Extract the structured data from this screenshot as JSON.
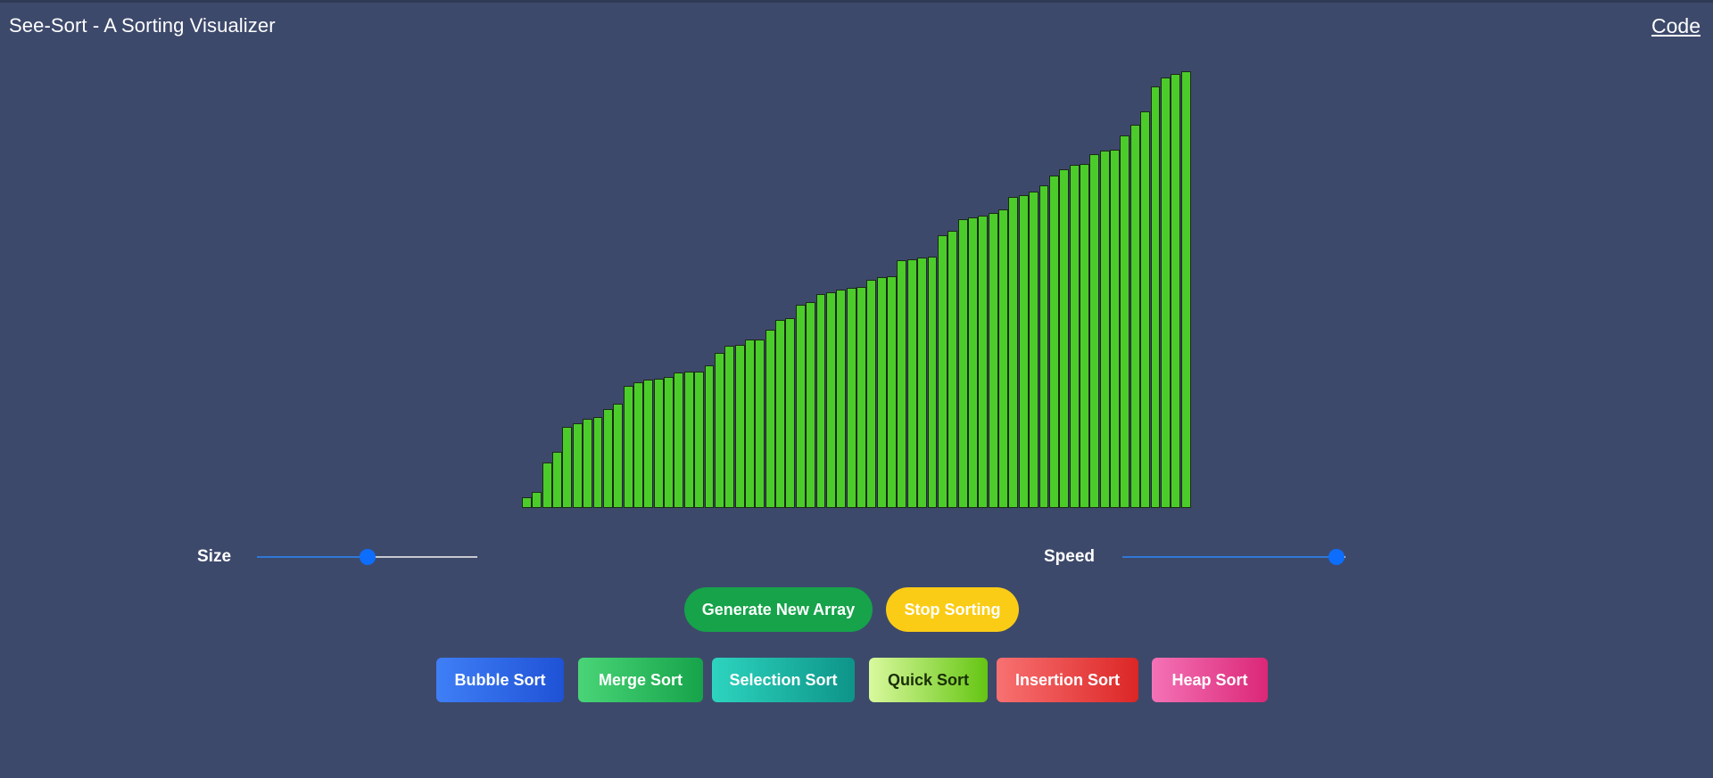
{
  "header": {
    "title": "See-Sort - A Sorting Visualizer",
    "code_link": "Code"
  },
  "array_values": [
    12,
    18,
    50,
    62,
    90,
    94,
    99,
    101,
    110,
    116,
    135,
    139,
    142,
    143,
    145,
    150,
    151,
    151,
    158,
    172,
    180,
    181,
    187,
    187,
    198,
    208,
    210,
    225,
    228,
    237,
    239,
    242,
    244,
    245,
    253,
    256,
    257,
    275,
    276,
    278,
    279,
    302,
    307,
    320,
    322,
    324,
    327,
    331,
    345,
    347,
    351,
    358,
    368,
    375,
    380,
    381,
    392,
    396,
    397,
    413,
    425,
    440,
    467,
    477,
    481,
    484
  ],
  "array_max": 484,
  "controls": {
    "size_label": "Size",
    "size_fraction": 0.5,
    "speed_label": "Speed",
    "speed_fraction": 0.96
  },
  "buttons": {
    "generate": "Generate New Array",
    "stop": "Stop Sorting"
  },
  "algorithms": [
    {
      "label": "Bubble Sort",
      "color_from": "#3f7ff6",
      "color_to": "#1f52d6",
      "text": "#ffffff"
    },
    {
      "label": "Merge Sort",
      "color_from": "#49d577",
      "color_to": "#16a34a",
      "text": "#ffffff"
    },
    {
      "label": "Selection Sort",
      "color_from": "#2dd4bf",
      "color_to": "#0d9488",
      "text": "#ffffff"
    },
    {
      "label": "Quick Sort",
      "color_from": "#d9f99d",
      "color_to": "#65c513",
      "text": "#1a2e05"
    },
    {
      "label": "Insertion Sort",
      "color_from": "#f87171",
      "color_to": "#dc2626",
      "text": "#ffffff"
    },
    {
      "label": "Heap Sort",
      "color_from": "#f472b6",
      "color_to": "#db2777",
      "text": "#ffffff"
    }
  ],
  "colors": {
    "background": "#3d496b",
    "bar": "#4ccc2a",
    "generate": "#16a34a",
    "stop": "#facc15"
  }
}
